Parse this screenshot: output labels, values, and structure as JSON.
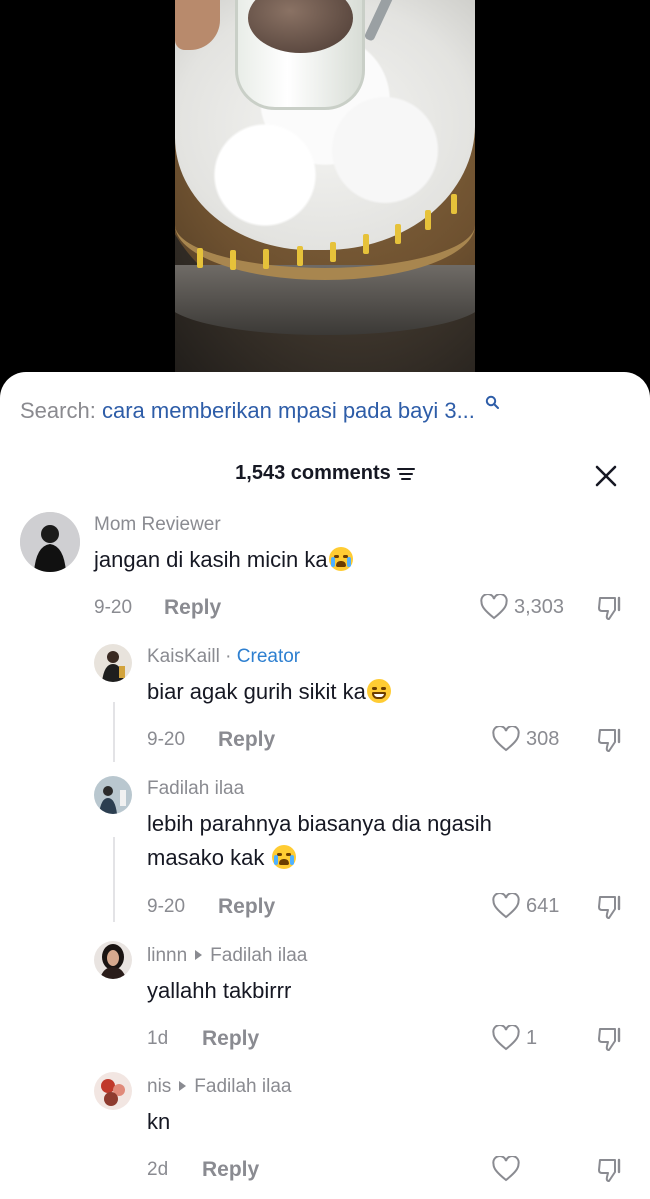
{
  "search": {
    "label": "Search:",
    "query": "cara memberikan mpasi pada bayi 3..."
  },
  "header": {
    "count": "1,543 comments"
  },
  "comments": [
    {
      "user": "Mom Reviewer",
      "text": "jangan di kasih micin ka",
      "emoji": "loudly-crying-face",
      "date": "9-20",
      "reply_label": "Reply",
      "likes": "3,303"
    },
    {
      "user": "KaisKaill",
      "separator": "·",
      "badge": "Creator",
      "text": "biar agak gurih sikit ka",
      "emoji": "grinning-face",
      "date": "9-20",
      "reply_label": "Reply",
      "likes": "308"
    },
    {
      "user": "Fadilah ilaa",
      "text_line1": "lebih parahnya biasanya dia ngasih",
      "text_line2": "masako kak",
      "emoji": "loudly-crying-face",
      "date": "9-20",
      "reply_label": "Reply",
      "likes": "641"
    },
    {
      "user": "linnn",
      "reply_to": "Fadilah ilaa",
      "text": "yallahh takbirrr",
      "date": "1d",
      "reply_label": "Reply",
      "likes": "1"
    },
    {
      "user": "nis",
      "reply_to": "Fadilah ilaa",
      "text": "kn",
      "date": "2d",
      "reply_label": "Reply",
      "likes": ""
    }
  ],
  "colors": {
    "link_blue": "#2e5da8",
    "creator_blue": "#2d7fd0",
    "muted_gray": "#8a8b91",
    "text_dark": "#161823"
  }
}
